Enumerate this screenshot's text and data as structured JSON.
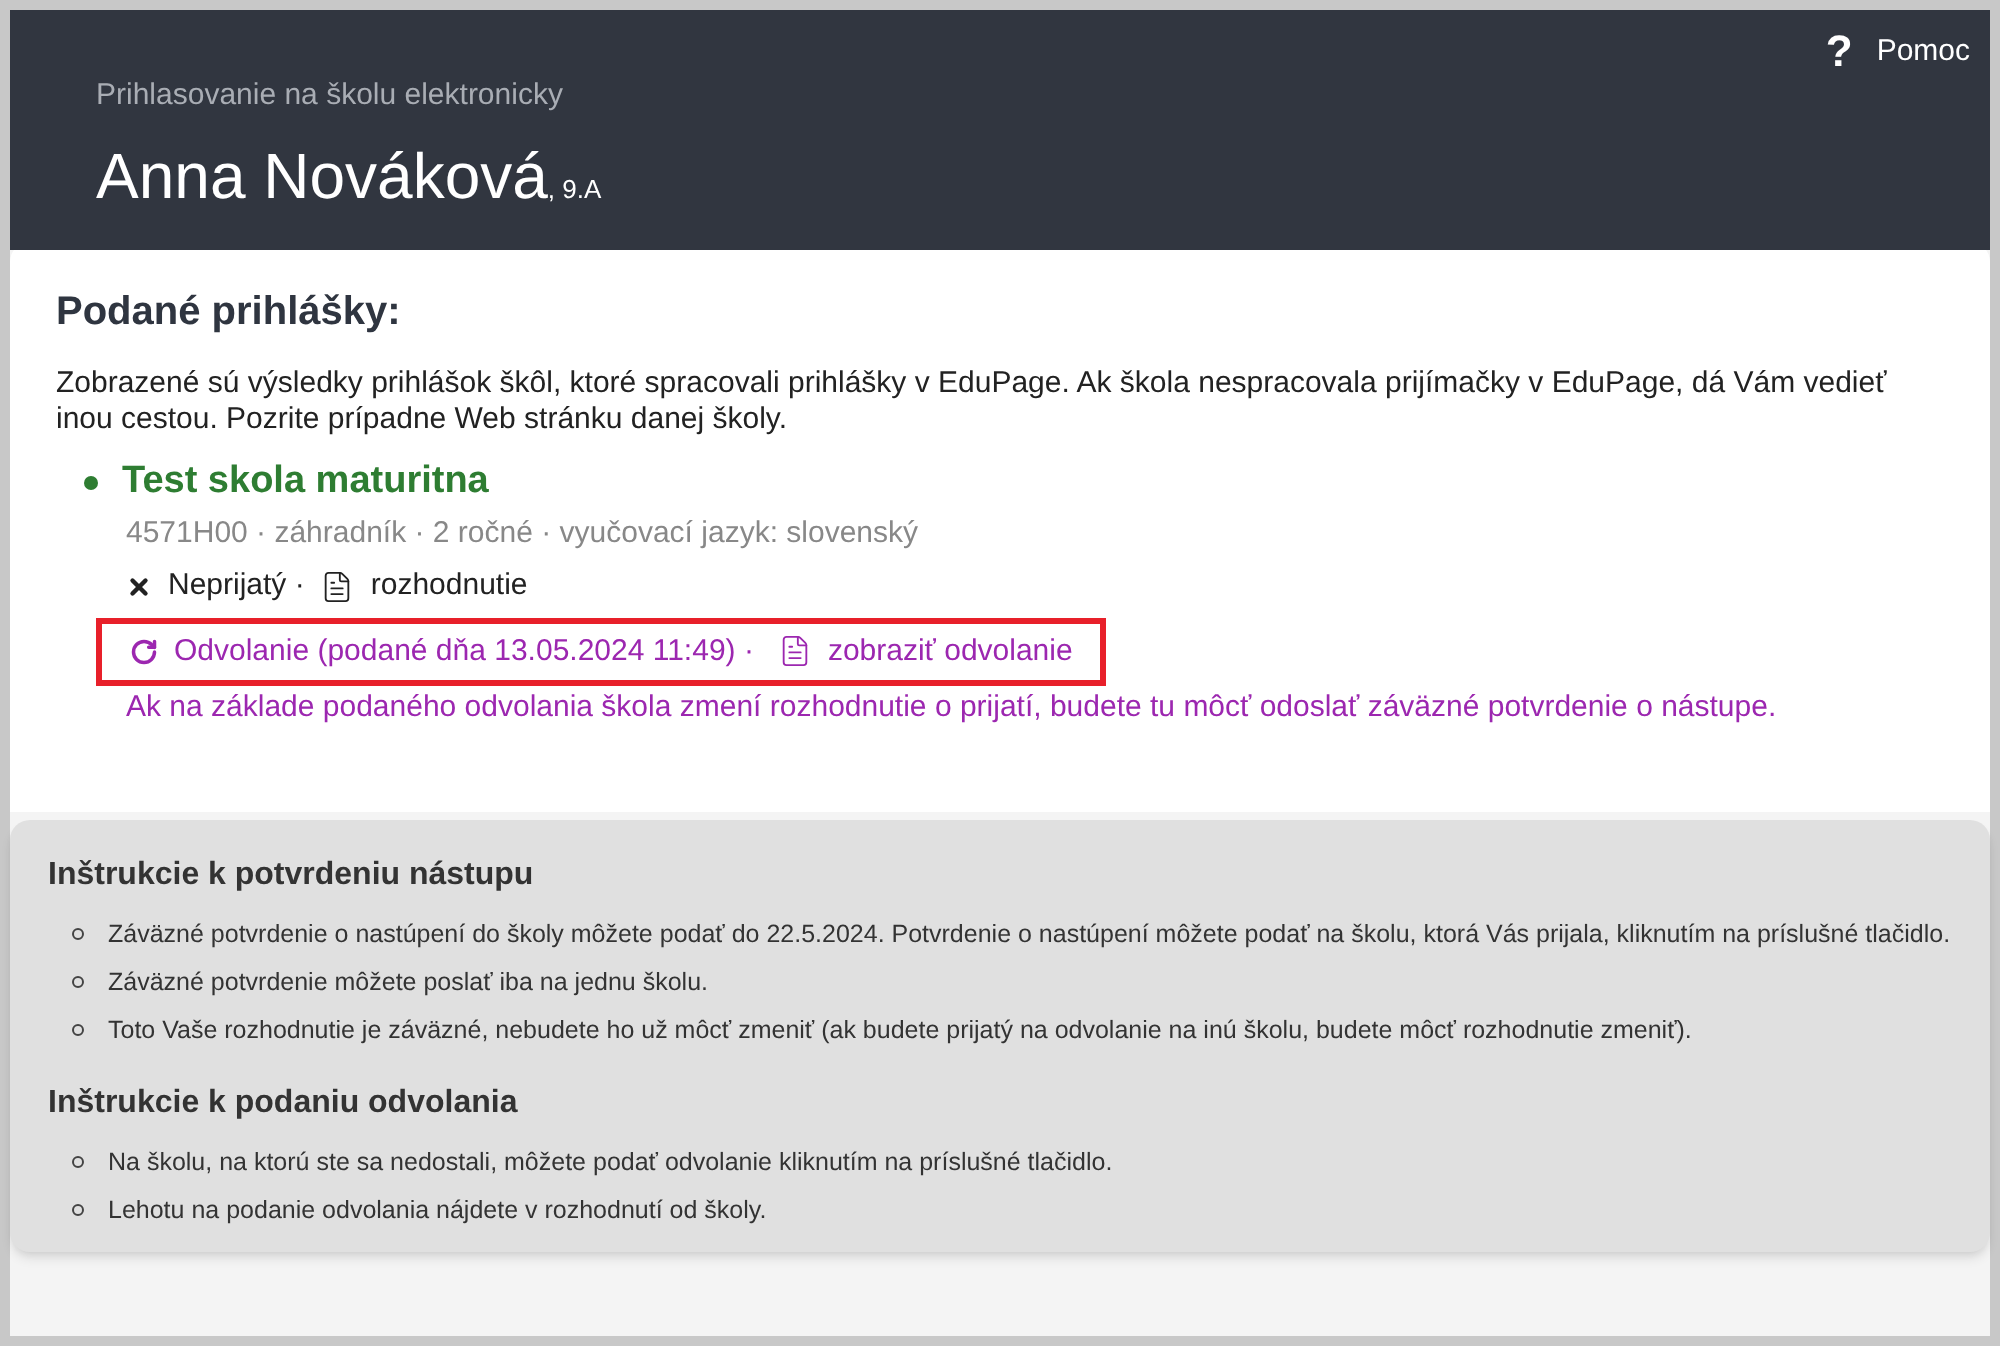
{
  "header": {
    "help_icon": "?",
    "help": "Pomoc",
    "subtitle": "Prihlasovanie na školu elektronicky",
    "name": "Anna Nováková",
    "class": ", 9.A"
  },
  "applications": {
    "title": "Podané prihlášky:",
    "intro": "Zobrazené sú výsledky prihlášok škôl, ktoré spracovali prihlášky v EduPage. Ak škola nespracovala prijímačky v EduPage, dá Vám vedieť inou cestou. Pozrite prípadne Web stránku danej školy.",
    "schools": [
      {
        "name": "Test skola maturitna",
        "details": "4571H00 · záhradník · 2 ročné · vyučovací jazyk: slovenský",
        "status": "Neprijatý ·",
        "decision": "rozhodnutie",
        "appeal": "Odvolanie (podané dňa 13.05.2024 11:49) ·",
        "appeal_link": "zobraziť odvolanie",
        "highlighted": true,
        "note": "Ak na základe podaného odvolania škola zmení rozhodnutie o prijatí, budete tu môcť odoslať záväzné potvrdenie o nástupe."
      }
    ]
  },
  "instructions": [
    {
      "title": "Inštrukcie k potvrdeniu nástupu",
      "items": [
        "Záväzné potvrdenie o nastúpení do školy môžete podať do 22.5.2024. Potvrdenie o nastúpení môžete podať na školu, ktorá Vás prijala, kliknutím na príslušné tlačidlo.",
        "Záväzné potvrdenie môžete poslať iba na jednu školu.",
        "Toto Vaše rozhodnutie je záväzné, nebudete ho už môcť zmeniť (ak budete prijatý na odvolanie na inú školu, budete môcť rozhodnutie zmeniť)."
      ]
    },
    {
      "title": "Inštrukcie k podaniu odvolania",
      "items": [
        "Na školu, na ktorú ste sa nedostali, môžete podať odvolanie kliknutím na príslušné tlačidlo.",
        "Lehotu na podanie odvolania nájdete v rozhodnutí od školy."
      ]
    }
  ]
}
